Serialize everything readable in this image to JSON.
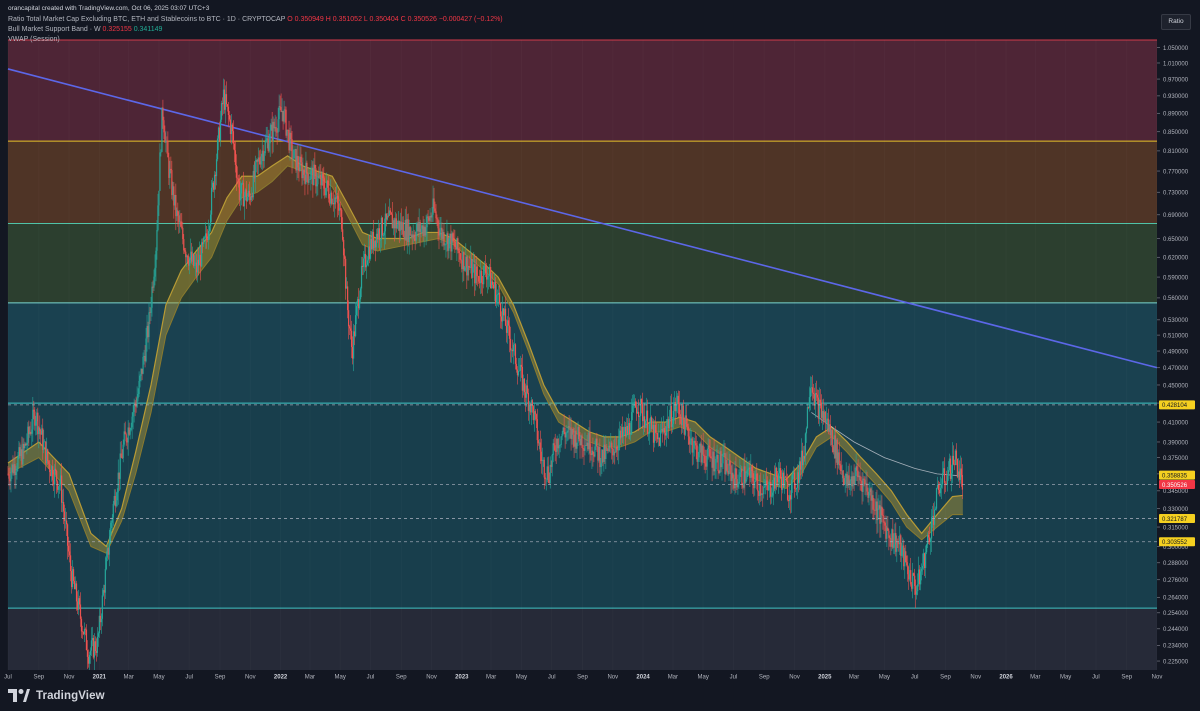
{
  "header": {
    "author": "orancapital created with TradingView.com, Oct 06, 2025 03:07 UTC+3",
    "symbol_line": "Ratio Total Market Cap Excluding BTC, ETH and Stablecoins to BTC · 1D · CRYPTOCAP",
    "ohlc": {
      "o": "O 0.350949",
      "h": "H 0.351052",
      "l": "L 0.350404",
      "c": "C 0.350526",
      "chg": "−0.000427 (−0.12%)"
    },
    "indicator1_label": "Bull Market Support Band · W",
    "indicator1_v1": "0.325155",
    "indicator1_v2": "0.341149",
    "indicator2_label": "VWAP (Session)"
  },
  "scale_button": "Ratio",
  "footer": {
    "brand": "TradingView"
  },
  "colors": {
    "bg": "#131722",
    "zone_red": "#4e2536",
    "zone_orange": "#4f3426",
    "zone_olive": "#2c3f2f",
    "zone_teal": "#1a4150",
    "zone_teal2": "#183e4c",
    "zone_bottom": "#262a38",
    "up": "#26a69a",
    "down": "#ef5350",
    "band": "#b89b35",
    "trend": "#5c67e8"
  },
  "chart_data": {
    "type": "candlestick",
    "title": "Ratio Total Market Cap Excluding BTC, ETH and Stablecoins to BTC",
    "y_scale": "log",
    "ylim": [
      0.22,
      1.07
    ],
    "x_range": [
      "2020-07-01",
      "2026-11-01"
    ],
    "y_ticks": [
      "1.050000",
      "1.010000",
      "0.970000",
      "0.930000",
      "0.890000",
      "0.850000",
      "0.810000",
      "0.770000",
      "0.730000",
      "0.690000",
      "0.650000",
      "0.620000",
      "0.590000",
      "0.560000",
      "0.530000",
      "0.510000",
      "0.490000",
      "0.470000",
      "0.450000",
      "0.430000",
      "0.410000",
      "0.390000",
      "0.375000",
      "0.360000",
      "0.345000",
      "0.330000",
      "0.315000",
      "0.300000",
      "0.288000",
      "0.276000",
      "0.264000",
      "0.254000",
      "0.244000",
      "0.234000",
      "0.225000"
    ],
    "x_ticks": [
      {
        "date": "2020-07-01",
        "label": "Jul"
      },
      {
        "date": "2020-09-01",
        "label": "Sep"
      },
      {
        "date": "2020-11-01",
        "label": "Nov"
      },
      {
        "date": "2021-01-01",
        "label": "2021"
      },
      {
        "date": "2021-03-01",
        "label": "Mar"
      },
      {
        "date": "2021-05-01",
        "label": "May"
      },
      {
        "date": "2021-07-01",
        "label": "Jul"
      },
      {
        "date": "2021-09-01",
        "label": "Sep"
      },
      {
        "date": "2021-11-01",
        "label": "Nov"
      },
      {
        "date": "2022-01-01",
        "label": "2022"
      },
      {
        "date": "2022-03-01",
        "label": "Mar"
      },
      {
        "date": "2022-05-01",
        "label": "May"
      },
      {
        "date": "2022-07-01",
        "label": "Jul"
      },
      {
        "date": "2022-09-01",
        "label": "Sep"
      },
      {
        "date": "2022-11-01",
        "label": "Nov"
      },
      {
        "date": "2023-01-01",
        "label": "2023"
      },
      {
        "date": "2023-03-01",
        "label": "Mar"
      },
      {
        "date": "2023-05-01",
        "label": "May"
      },
      {
        "date": "2023-07-01",
        "label": "Jul"
      },
      {
        "date": "2023-09-01",
        "label": "Sep"
      },
      {
        "date": "2023-11-01",
        "label": "Nov"
      },
      {
        "date": "2024-01-01",
        "label": "2024"
      },
      {
        "date": "2024-03-01",
        "label": "Mar"
      },
      {
        "date": "2024-05-01",
        "label": "May"
      },
      {
        "date": "2024-07-01",
        "label": "Jul"
      },
      {
        "date": "2024-09-01",
        "label": "Sep"
      },
      {
        "date": "2024-11-01",
        "label": "Nov"
      },
      {
        "date": "2025-01-01",
        "label": "2025"
      },
      {
        "date": "2025-03-01",
        "label": "Mar"
      },
      {
        "date": "2025-05-01",
        "label": "May"
      },
      {
        "date": "2025-07-01",
        "label": "Jul"
      },
      {
        "date": "2025-09-01",
        "label": "Sep"
      },
      {
        "date": "2025-11-01",
        "label": "Nov"
      },
      {
        "date": "2026-01-01",
        "label": "2026"
      },
      {
        "date": "2026-03-01",
        "label": "Mar"
      },
      {
        "date": "2026-05-01",
        "label": "May"
      },
      {
        "date": "2026-07-01",
        "label": "Jul"
      },
      {
        "date": "2026-09-01",
        "label": "Sep"
      },
      {
        "date": "2026-11-01",
        "label": "Nov"
      }
    ],
    "zones": [
      {
        "name": "red",
        "from": 0.83,
        "to": 1.07,
        "color": "#4e2536",
        "line": "#d23a4a"
      },
      {
        "name": "orange",
        "from": 0.675,
        "to": 0.83,
        "color": "#4f3426",
        "line": "#e6c229"
      },
      {
        "name": "olive",
        "from": 0.553,
        "to": 0.675,
        "color": "#2c3f2f",
        "line": "#4fc3a8"
      },
      {
        "name": "teal",
        "from": 0.43,
        "to": 0.553,
        "color": "#1a4150",
        "line": "#7ad6d0"
      },
      {
        "name": "teal2",
        "from": 0.257,
        "to": 0.43,
        "color": "#183e4c",
        "line": "#3fc4c4"
      },
      {
        "name": "bottom",
        "from": 0.22,
        "to": 0.257,
        "color": "#262a38",
        "line": ""
      }
    ],
    "dashed_levels": [
      {
        "value": 0.428104,
        "label": "0.428104",
        "color": "#aeb4c2"
      },
      {
        "value": 0.350526,
        "label": "0.350526",
        "color": "#aeb4c2"
      },
      {
        "value": 0.321787,
        "label": "0.321787",
        "color": "#aeb4c2"
      },
      {
        "value": 0.303552,
        "label": "0.303552",
        "color": "#aeb4c2"
      }
    ],
    "price_tags": [
      {
        "value": 0.428104,
        "label": "0.428104",
        "bg": "#f5d020",
        "fg": "#131722"
      },
      {
        "value": 0.358835,
        "label": "0.358835",
        "bg": "#f5d020",
        "fg": "#131722"
      },
      {
        "value": 0.350526,
        "label": "0.350526",
        "bg": "#f23645",
        "fg": "#ffffff"
      },
      {
        "value": 0.321787,
        "label": "0.321787",
        "bg": "#f5d020",
        "fg": "#131722"
      },
      {
        "value": 0.303552,
        "label": "0.303552",
        "bg": "#f5d020",
        "fg": "#131722"
      }
    ],
    "trendline": {
      "from": {
        "date": "2020-07-01",
        "value": 0.995
      },
      "to": {
        "date": "2026-11-01",
        "value": 0.47
      },
      "color": "#5c67e8"
    },
    "price_path": [
      [
        "2020-07-01",
        0.36
      ],
      [
        "2020-08-01",
        0.38
      ],
      [
        "2020-08-25",
        0.42
      ],
      [
        "2020-09-20",
        0.37
      ],
      [
        "2020-10-15",
        0.35
      ],
      [
        "2020-11-05",
        0.28
      ],
      [
        "2020-11-25",
        0.25
      ],
      [
        "2020-12-10",
        0.23
      ],
      [
        "2020-12-28",
        0.235
      ],
      [
        "2021-01-10",
        0.27
      ],
      [
        "2021-01-28",
        0.33
      ],
      [
        "2021-02-20",
        0.39
      ],
      [
        "2021-03-20",
        0.44
      ],
      [
        "2021-04-10",
        0.52
      ],
      [
        "2021-04-25",
        0.64
      ],
      [
        "2021-05-08",
        0.9
      ],
      [
        "2021-05-20",
        0.78
      ],
      [
        "2021-06-05",
        0.69
      ],
      [
        "2021-06-25",
        0.63
      ],
      [
        "2021-07-15",
        0.6
      ],
      [
        "2021-08-05",
        0.65
      ],
      [
        "2021-08-25",
        0.8
      ],
      [
        "2021-09-08",
        0.93
      ],
      [
        "2021-09-25",
        0.85
      ],
      [
        "2021-10-10",
        0.73
      ],
      [
        "2021-10-30",
        0.72
      ],
      [
        "2021-11-20",
        0.8
      ],
      [
        "2021-12-15",
        0.85
      ],
      [
        "2022-01-05",
        0.9
      ],
      [
        "2022-01-25",
        0.8
      ],
      [
        "2022-02-15",
        0.77
      ],
      [
        "2022-03-10",
        0.76
      ],
      [
        "2022-04-01",
        0.74
      ],
      [
        "2022-04-20",
        0.72
      ],
      [
        "2022-05-05",
        0.68
      ],
      [
        "2022-05-15",
        0.55
      ],
      [
        "2022-05-25",
        0.49
      ],
      [
        "2022-06-10",
        0.58
      ],
      [
        "2022-06-25",
        0.63
      ],
      [
        "2022-07-15",
        0.66
      ],
      [
        "2022-08-10",
        0.68
      ],
      [
        "2022-09-01",
        0.67
      ],
      [
        "2022-09-25",
        0.66
      ],
      [
        "2022-10-20",
        0.67
      ],
      [
        "2022-11-05",
        0.7
      ],
      [
        "2022-11-20",
        0.66
      ],
      [
        "2022-12-15",
        0.64
      ],
      [
        "2023-01-10",
        0.61
      ],
      [
        "2023-02-01",
        0.59
      ],
      [
        "2023-02-20",
        0.6
      ],
      [
        "2023-03-15",
        0.56
      ],
      [
        "2023-04-10",
        0.5
      ],
      [
        "2023-05-05",
        0.45
      ],
      [
        "2023-05-25",
        0.42
      ],
      [
        "2023-06-12",
        0.37
      ],
      [
        "2023-06-25",
        0.36
      ],
      [
        "2023-07-10",
        0.39
      ],
      [
        "2023-07-25",
        0.4
      ],
      [
        "2023-08-20",
        0.395
      ],
      [
        "2023-09-15",
        0.39
      ],
      [
        "2023-10-10",
        0.375
      ],
      [
        "2023-10-25",
        0.38
      ],
      [
        "2023-11-10",
        0.39
      ],
      [
        "2023-12-01",
        0.4
      ],
      [
        "2023-12-20",
        0.43
      ],
      [
        "2024-01-10",
        0.41
      ],
      [
        "2024-01-30",
        0.39
      ],
      [
        "2024-02-20",
        0.41
      ],
      [
        "2024-03-10",
        0.43
      ],
      [
        "2024-03-30",
        0.4
      ],
      [
        "2024-04-20",
        0.38
      ],
      [
        "2024-05-15",
        0.375
      ],
      [
        "2024-06-10",
        0.37
      ],
      [
        "2024-07-05",
        0.355
      ],
      [
        "2024-07-30",
        0.36
      ],
      [
        "2024-08-20",
        0.35
      ],
      [
        "2024-09-10",
        0.345
      ],
      [
        "2024-09-30",
        0.36
      ],
      [
        "2024-10-20",
        0.345
      ],
      [
        "2024-11-05",
        0.355
      ],
      [
        "2024-11-20",
        0.38
      ],
      [
        "2024-12-03",
        0.46
      ],
      [
        "2024-12-15",
        0.43
      ],
      [
        "2025-01-05",
        0.41
      ],
      [
        "2025-01-25",
        0.38
      ],
      [
        "2025-02-15",
        0.35
      ],
      [
        "2025-03-05",
        0.36
      ],
      [
        "2025-03-25",
        0.35
      ],
      [
        "2025-04-15",
        0.33
      ],
      [
        "2025-05-10",
        0.31
      ],
      [
        "2025-06-01",
        0.3
      ],
      [
        "2025-06-20",
        0.28
      ],
      [
        "2025-07-05",
        0.27
      ],
      [
        "2025-07-20",
        0.29
      ],
      [
        "2025-08-05",
        0.32
      ],
      [
        "2025-08-20",
        0.35
      ],
      [
        "2025-09-05",
        0.36
      ],
      [
        "2025-09-20",
        0.375
      ],
      [
        "2025-10-06",
        0.3505
      ]
    ],
    "band_upper": [
      [
        "2020-07-01",
        0.37
      ],
      [
        "2020-09-01",
        0.39
      ],
      [
        "2020-11-01",
        0.36
      ],
      [
        "2020-12-15",
        0.31
      ],
      [
        "2021-01-15",
        0.3
      ],
      [
        "2021-02-15",
        0.33
      ],
      [
        "2021-03-15",
        0.38
      ],
      [
        "2021-04-15",
        0.45
      ],
      [
        "2021-05-15",
        0.55
      ],
      [
        "2021-06-15",
        0.6
      ],
      [
        "2021-07-15",
        0.63
      ],
      [
        "2021-08-15",
        0.66
      ],
      [
        "2021-09-15",
        0.72
      ],
      [
        "2021-10-15",
        0.76
      ],
      [
        "2021-11-15",
        0.76
      ],
      [
        "2021-12-15",
        0.78
      ],
      [
        "2022-01-15",
        0.8
      ],
      [
        "2022-02-15",
        0.78
      ],
      [
        "2022-03-15",
        0.77
      ],
      [
        "2022-04-15",
        0.76
      ],
      [
        "2022-05-15",
        0.71
      ],
      [
        "2022-06-15",
        0.66
      ],
      [
        "2022-07-15",
        0.65
      ],
      [
        "2022-08-15",
        0.65
      ],
      [
        "2022-09-15",
        0.65
      ],
      [
        "2022-10-15",
        0.66
      ],
      [
        "2022-11-15",
        0.66
      ],
      [
        "2022-12-15",
        0.65
      ],
      [
        "2023-01-15",
        0.63
      ],
      [
        "2023-02-15",
        0.61
      ],
      [
        "2023-03-15",
        0.59
      ],
      [
        "2023-04-15",
        0.55
      ],
      [
        "2023-05-15",
        0.5
      ],
      [
        "2023-06-15",
        0.45
      ],
      [
        "2023-07-15",
        0.42
      ],
      [
        "2023-08-15",
        0.41
      ],
      [
        "2023-09-15",
        0.4
      ],
      [
        "2023-10-15",
        0.395
      ],
      [
        "2023-11-15",
        0.395
      ],
      [
        "2023-12-15",
        0.4
      ],
      [
        "2024-01-15",
        0.41
      ],
      [
        "2024-02-15",
        0.41
      ],
      [
        "2024-03-15",
        0.415
      ],
      [
        "2024-04-15",
        0.41
      ],
      [
        "2024-05-15",
        0.395
      ],
      [
        "2024-06-15",
        0.385
      ],
      [
        "2024-07-15",
        0.375
      ],
      [
        "2024-08-15",
        0.365
      ],
      [
        "2024-09-15",
        0.36
      ],
      [
        "2024-10-15",
        0.355
      ],
      [
        "2024-11-15",
        0.37
      ],
      [
        "2024-12-15",
        0.395
      ],
      [
        "2025-01-15",
        0.405
      ],
      [
        "2025-02-15",
        0.39
      ],
      [
        "2025-03-15",
        0.375
      ],
      [
        "2025-04-15",
        0.36
      ],
      [
        "2025-05-15",
        0.345
      ],
      [
        "2025-06-15",
        0.325
      ],
      [
        "2025-07-15",
        0.31
      ],
      [
        "2025-08-15",
        0.325
      ],
      [
        "2025-09-15",
        0.34
      ],
      [
        "2025-10-06",
        0.341
      ]
    ],
    "band_lower": [
      [
        "2020-07-01",
        0.36
      ],
      [
        "2020-09-01",
        0.375
      ],
      [
        "2020-11-01",
        0.345
      ],
      [
        "2020-12-15",
        0.3
      ],
      [
        "2021-01-15",
        0.295
      ],
      [
        "2021-02-15",
        0.32
      ],
      [
        "2021-03-15",
        0.36
      ],
      [
        "2021-04-15",
        0.42
      ],
      [
        "2021-05-15",
        0.51
      ],
      [
        "2021-06-15",
        0.56
      ],
      [
        "2021-07-15",
        0.59
      ],
      [
        "2021-08-15",
        0.62
      ],
      [
        "2021-09-15",
        0.68
      ],
      [
        "2021-10-15",
        0.72
      ],
      [
        "2021-11-15",
        0.73
      ],
      [
        "2021-12-15",
        0.75
      ],
      [
        "2022-01-15",
        0.78
      ],
      [
        "2022-02-15",
        0.77
      ],
      [
        "2022-03-15",
        0.76
      ],
      [
        "2022-04-15",
        0.74
      ],
      [
        "2022-05-15",
        0.69
      ],
      [
        "2022-06-15",
        0.64
      ],
      [
        "2022-07-15",
        0.63
      ],
      [
        "2022-08-15",
        0.635
      ],
      [
        "2022-09-15",
        0.64
      ],
      [
        "2022-10-15",
        0.645
      ],
      [
        "2022-11-15",
        0.65
      ],
      [
        "2022-12-15",
        0.64
      ],
      [
        "2023-01-15",
        0.62
      ],
      [
        "2023-02-15",
        0.6
      ],
      [
        "2023-03-15",
        0.58
      ],
      [
        "2023-04-15",
        0.54
      ],
      [
        "2023-05-15",
        0.49
      ],
      [
        "2023-06-15",
        0.44
      ],
      [
        "2023-07-15",
        0.41
      ],
      [
        "2023-08-15",
        0.4
      ],
      [
        "2023-09-15",
        0.39
      ],
      [
        "2023-10-15",
        0.385
      ],
      [
        "2023-11-15",
        0.385
      ],
      [
        "2023-12-15",
        0.39
      ],
      [
        "2024-01-15",
        0.4
      ],
      [
        "2024-02-15",
        0.4
      ],
      [
        "2024-03-15",
        0.405
      ],
      [
        "2024-04-15",
        0.4
      ],
      [
        "2024-05-15",
        0.385
      ],
      [
        "2024-06-15",
        0.375
      ],
      [
        "2024-07-15",
        0.365
      ],
      [
        "2024-08-15",
        0.355
      ],
      [
        "2024-09-15",
        0.35
      ],
      [
        "2024-10-15",
        0.347
      ],
      [
        "2024-11-15",
        0.36
      ],
      [
        "2024-12-15",
        0.385
      ],
      [
        "2025-01-15",
        0.395
      ],
      [
        "2025-02-15",
        0.38
      ],
      [
        "2025-03-15",
        0.365
      ],
      [
        "2025-04-15",
        0.35
      ],
      [
        "2025-05-15",
        0.335
      ],
      [
        "2025-06-15",
        0.315
      ],
      [
        "2025-07-15",
        0.305
      ],
      [
        "2025-08-15",
        0.315
      ],
      [
        "2025-09-15",
        0.325
      ],
      [
        "2025-10-06",
        0.325
      ]
    ],
    "vwap": [
      [
        "2024-12-05",
        0.42
      ],
      [
        "2025-01-15",
        0.405
      ],
      [
        "2025-03-01",
        0.39
      ],
      [
        "2025-05-01",
        0.375
      ],
      [
        "2025-07-01",
        0.365
      ],
      [
        "2025-08-15",
        0.36
      ],
      [
        "2025-10-06",
        0.358
      ]
    ]
  }
}
